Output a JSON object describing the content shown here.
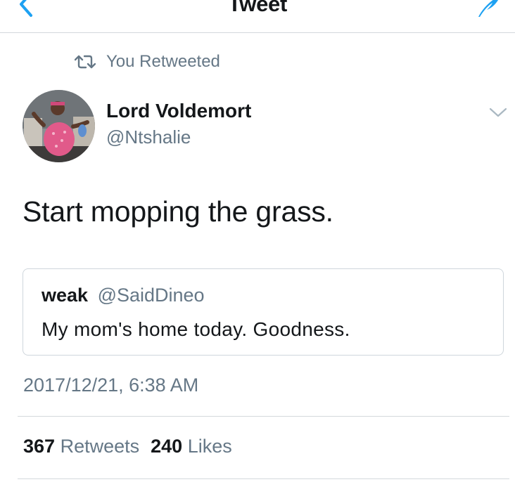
{
  "nav": {
    "title": "Tweet",
    "back_icon": "chevron-left-icon",
    "compose_icon": "feather-compose-icon",
    "accent": "#1da1f2"
  },
  "retweet": {
    "icon": "retweet-icon",
    "label": "You Retweeted"
  },
  "author": {
    "name": "Lord Voldemort",
    "handle": "@Ntshalie",
    "avatar_icon": "profile-photo"
  },
  "tweet": {
    "text": "Start mopping the grass."
  },
  "quoted": {
    "name": "weak",
    "handle": "@SaidDineo",
    "text": "My mom's home today. Goodness."
  },
  "timestamp": "2017/12/21, 6:38 AM",
  "stats": {
    "retweets_count": "367",
    "retweets_label": "Retweets",
    "likes_count": "240",
    "likes_label": "Likes"
  },
  "colors": {
    "text": "#14171a",
    "secondary": "#657786",
    "divider": "#d3d8dc",
    "accent": "#1da1f2"
  }
}
